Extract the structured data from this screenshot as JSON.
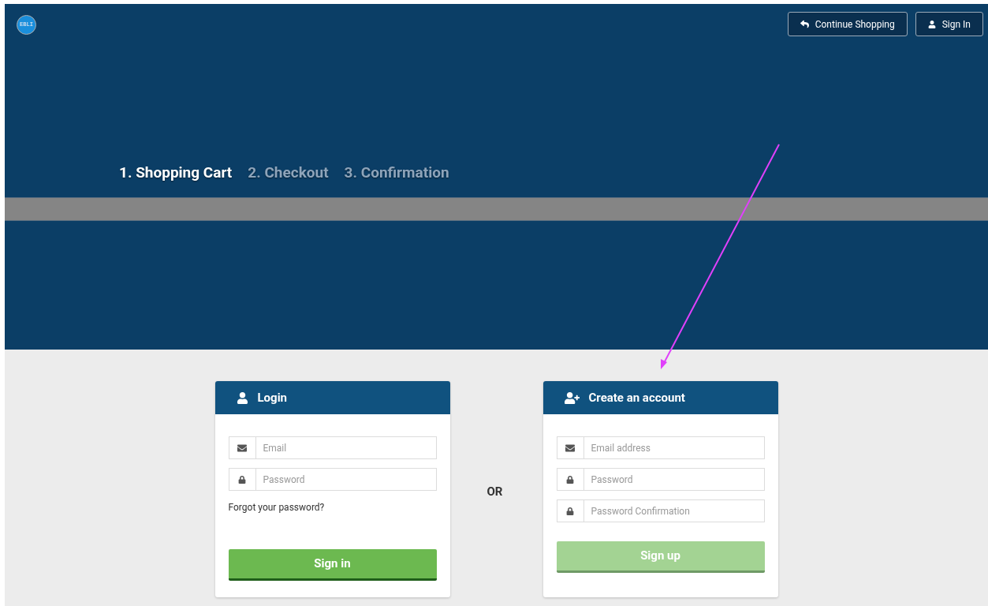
{
  "logo": {
    "text": "EBLI"
  },
  "header_buttons": [
    {
      "kind": "back",
      "label": "Continue Shopping"
    },
    {
      "kind": "user",
      "label": "Sign In"
    }
  ],
  "steps": [
    {
      "label": "1. Shopping Cart",
      "selected": true
    },
    {
      "label": "2. Checkout",
      "selected": false
    },
    {
      "label": "3. Confirmation",
      "selected": false
    }
  ],
  "login": {
    "title": "Login",
    "fields": [
      {
        "kind": "email",
        "placeholder": "Email"
      },
      {
        "kind": "password",
        "placeholder": "Password"
      }
    ],
    "forgot_link": "Forgot your password?",
    "button": {
      "label": "Sign in",
      "disabled": false
    }
  },
  "separator": "OR",
  "signup": {
    "title": "Create an account",
    "fields": [
      {
        "kind": "email",
        "placeholder": "Email address"
      },
      {
        "kind": "password",
        "placeholder": "Password"
      },
      {
        "kind": "password",
        "placeholder": "Password Confirmation"
      }
    ],
    "button": {
      "label": "Sign up",
      "disabled": true
    }
  }
}
